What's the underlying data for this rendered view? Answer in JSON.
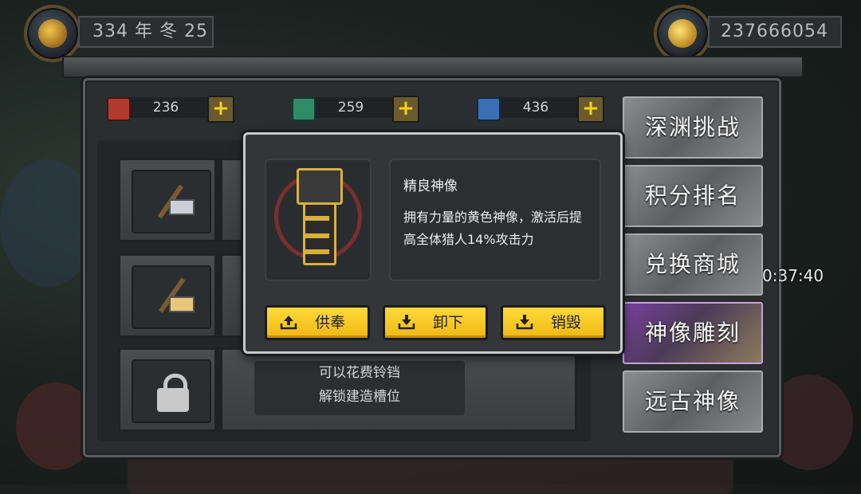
{
  "hud": {
    "date": "334 年 冬 25",
    "gold": "237666054"
  },
  "resources": [
    {
      "icon": "red-gem-icon",
      "color": "#b33a2c",
      "value": "236"
    },
    {
      "icon": "green-gem-icon",
      "color": "#2f8c6a",
      "value": "259"
    },
    {
      "icon": "blue-gem-icon",
      "color": "#3a6fb5",
      "value": "436"
    }
  ],
  "slots": {
    "locked_text": [
      "可以花费铃铛",
      "解锁建造槽位"
    ]
  },
  "tabs": [
    {
      "label": "深渊挑战",
      "active": false
    },
    {
      "label": "积分排名",
      "active": false
    },
    {
      "label": "兑换商城",
      "active": false
    },
    {
      "label": "神像雕刻",
      "active": true
    },
    {
      "label": "远古神像",
      "active": false
    }
  ],
  "popup": {
    "title": "精良神像",
    "description": "拥有力量的黄色神像，激活后提高全体猎人14%攻击力",
    "buttons": [
      "供奉",
      "卸下",
      "销毁"
    ]
  },
  "timer": "0:37:40",
  "colors": {
    "accent_yellow": "#f4c81f",
    "active_tab": "#7a3fa0",
    "panel": "#2b2e30"
  }
}
